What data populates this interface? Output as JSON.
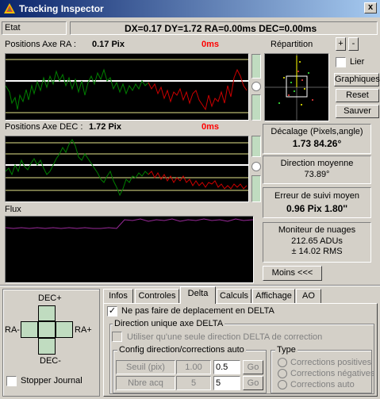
{
  "window": {
    "title": "Tracking Inspector",
    "close_label": "x"
  },
  "status": {
    "etat_label": "Etat",
    "readout": "DX=0.17  DY=1.72 RA=0.00ms  DEC=0.00ms"
  },
  "ra": {
    "label": "Positions Axe RA :",
    "value": "0.17 Pix",
    "ms": "0ms"
  },
  "dec": {
    "label": "Positions Axe DEC :",
    "value": "1.72 Pix",
    "ms": "0ms"
  },
  "flux": {
    "label": "Flux"
  },
  "repartition": {
    "label": "Répartition",
    "plus": "+",
    "minus": "-",
    "lier": "Lier",
    "graphiques": "Graphiques",
    "reset": "Reset",
    "sauver": "Sauver"
  },
  "stats": {
    "decalage": {
      "title": "Décalage (Pixels,angle)",
      "value": "1.73  84.26°"
    },
    "direction": {
      "title": "Direction moyenne",
      "value": "73.89°"
    },
    "erreur": {
      "title": "Erreur de suivi moyen",
      "value": "0.96 Pix  1.80''"
    },
    "nuages": {
      "title": "Moniteur de nuages",
      "adu": "212.65 ADUs",
      "rms": "± 14.02 RMS"
    },
    "moins": "Moins <<<"
  },
  "pad": {
    "dec_plus": "DEC+",
    "dec_minus": "DEC-",
    "ra_minus": "RA-",
    "ra_plus": "RA+",
    "stopper": "Stopper Journal"
  },
  "tabs": [
    {
      "label": "Infos"
    },
    {
      "label": "Controles"
    },
    {
      "label": "Delta"
    },
    {
      "label": "Calculs"
    },
    {
      "label": "Affichage"
    },
    {
      "label": "AO"
    }
  ],
  "delta": {
    "no_move": "Ne pas faire de deplacement en DELTA",
    "group_title": "Direction unique axe DELTA",
    "use_single": "Utiliser qu'une seule direction DELTA de correction",
    "config_title": "Config direction/corrections auto",
    "seuil_label": "Seuil (pix)",
    "seuil_value": "1.00",
    "seuil_input": "0.5",
    "nbre_label": "Nbre acq",
    "nbre_value": "5",
    "nbre_input": "5",
    "go": "Go",
    "type_title": "Type",
    "type_options": [
      "Corrections positives",
      "Corrections négatives",
      "Corrections auto"
    ]
  },
  "colors": {
    "plot_bg": "#000000",
    "ra_good": "#008000",
    "ra_bad": "#cc0000",
    "baseline": "#ffffff",
    "limits": "#e6e68c",
    "flux_line": "#9a2a9a",
    "title_start": "#0a246a",
    "title_end": "#a6caf0"
  }
}
